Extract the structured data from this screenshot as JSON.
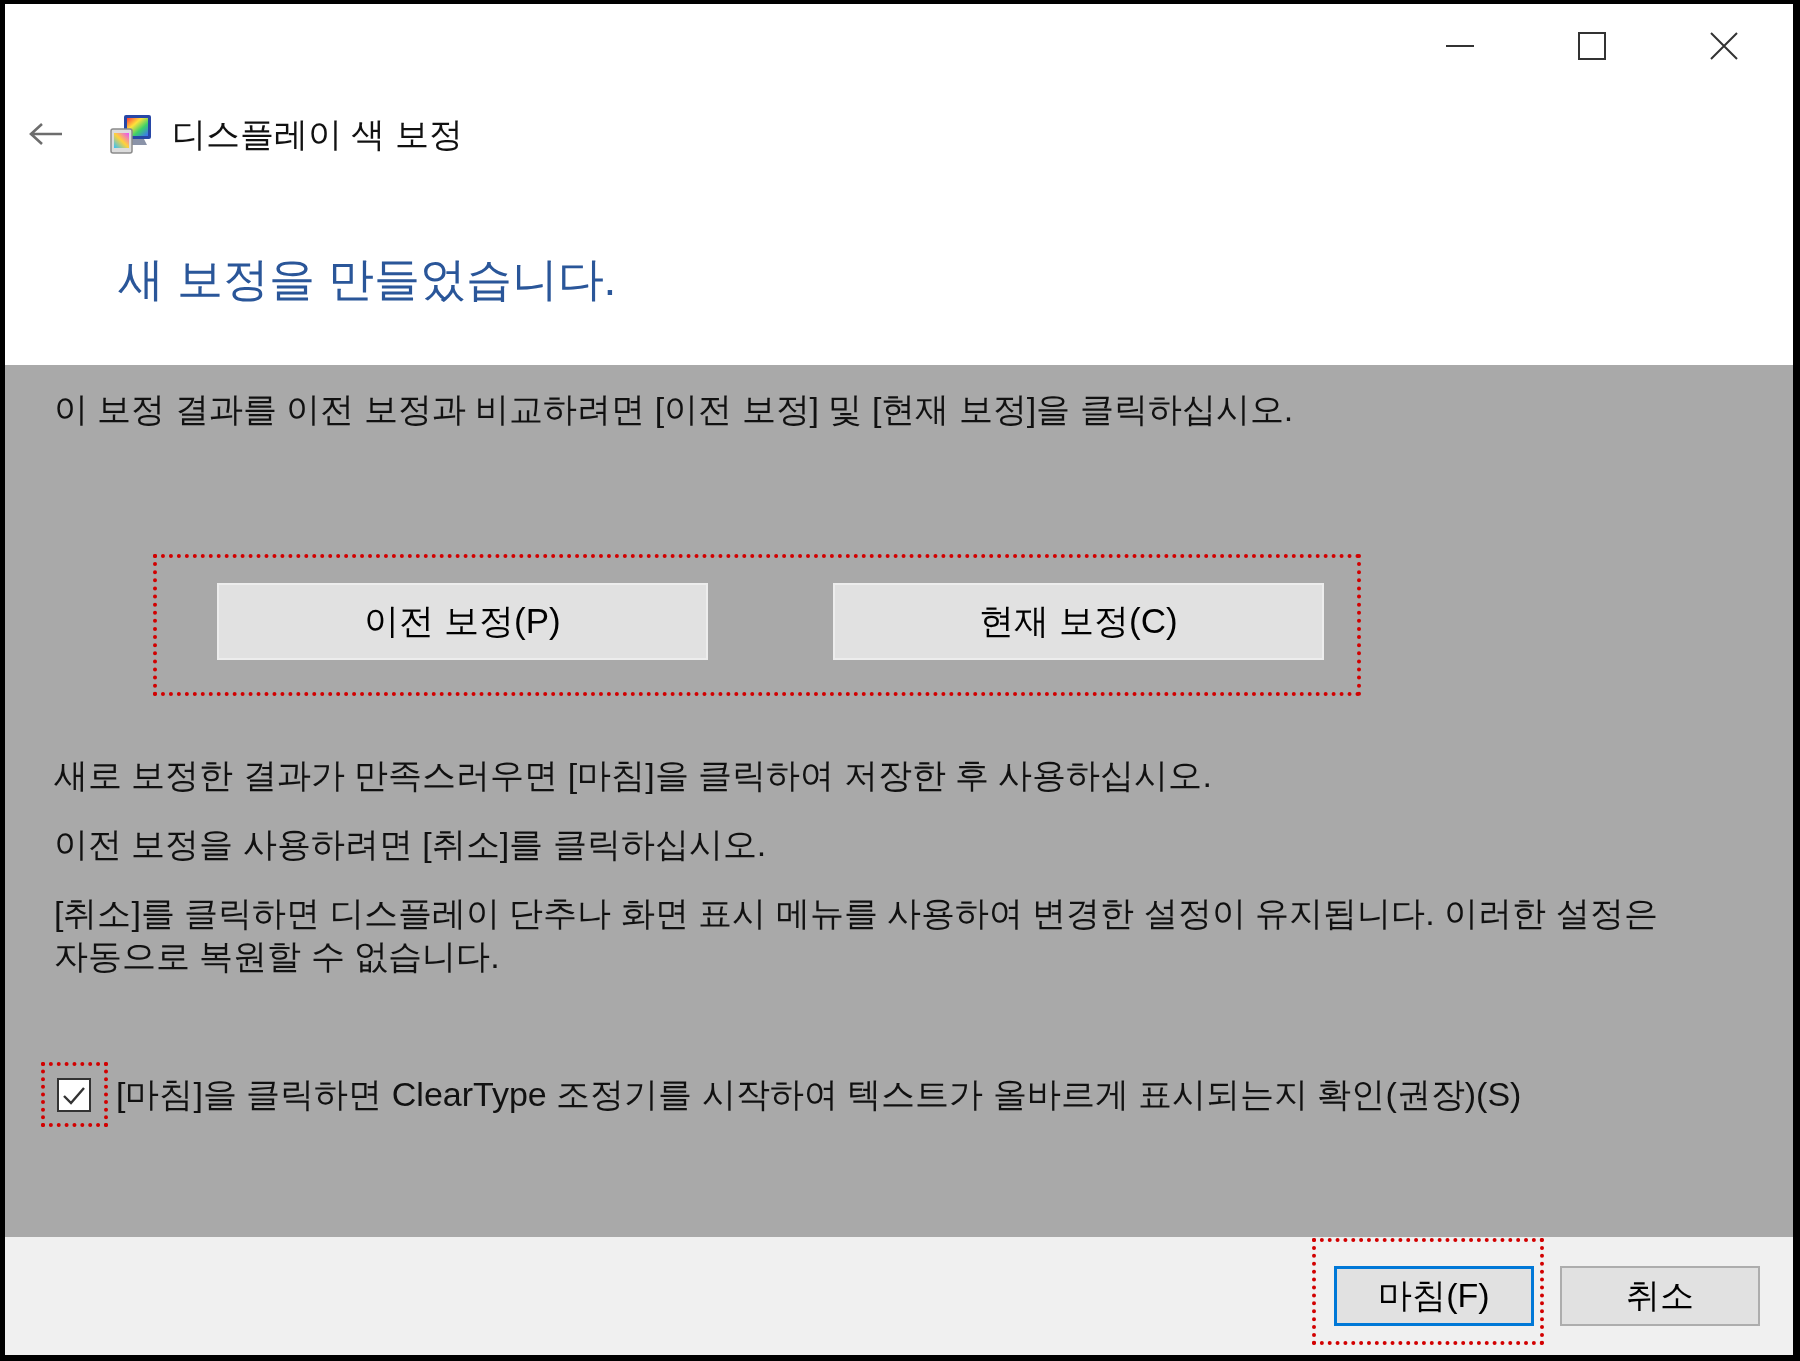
{
  "window": {
    "title": "디스플레이 색 보정"
  },
  "heading": "새 보정을 만들었습니다.",
  "intro": "이 보정 결과를 이전 보정과 비교하려면 [이전 보정] 및 [현재 보정]을 클릭하십시오.",
  "compare": {
    "highlighted": true,
    "buttons": [
      {
        "label": "이전 보정(P)"
      },
      {
        "label": "현재 보정(C)"
      }
    ]
  },
  "paragraphs": [
    "새로 보정한 결과가 만족스러우면 [마침]을 클릭하여 저장한 후 사용하십시오.",
    "이전 보정을 사용하려면 [취소]를 클릭하십시오.",
    "[취소]를 클릭하면 디스플레이 단추나 화면 표시 메뉴를 사용하여 변경한 설정이 유지됩니다. 이러한 설정은 자동으로 복원할 수 없습니다."
  ],
  "cleartype_option": {
    "label": "[마침]을 클릭하면 ClearType 조정기를 시작하여 텍스트가 올바르게 표시되는지 확인(권장)(S)",
    "checked": true,
    "highlighted": true
  },
  "footer_buttons": [
    {
      "label": "마침(F)",
      "default": true,
      "highlighted": true
    },
    {
      "label": "취소",
      "default": false,
      "highlighted": false
    }
  ]
}
